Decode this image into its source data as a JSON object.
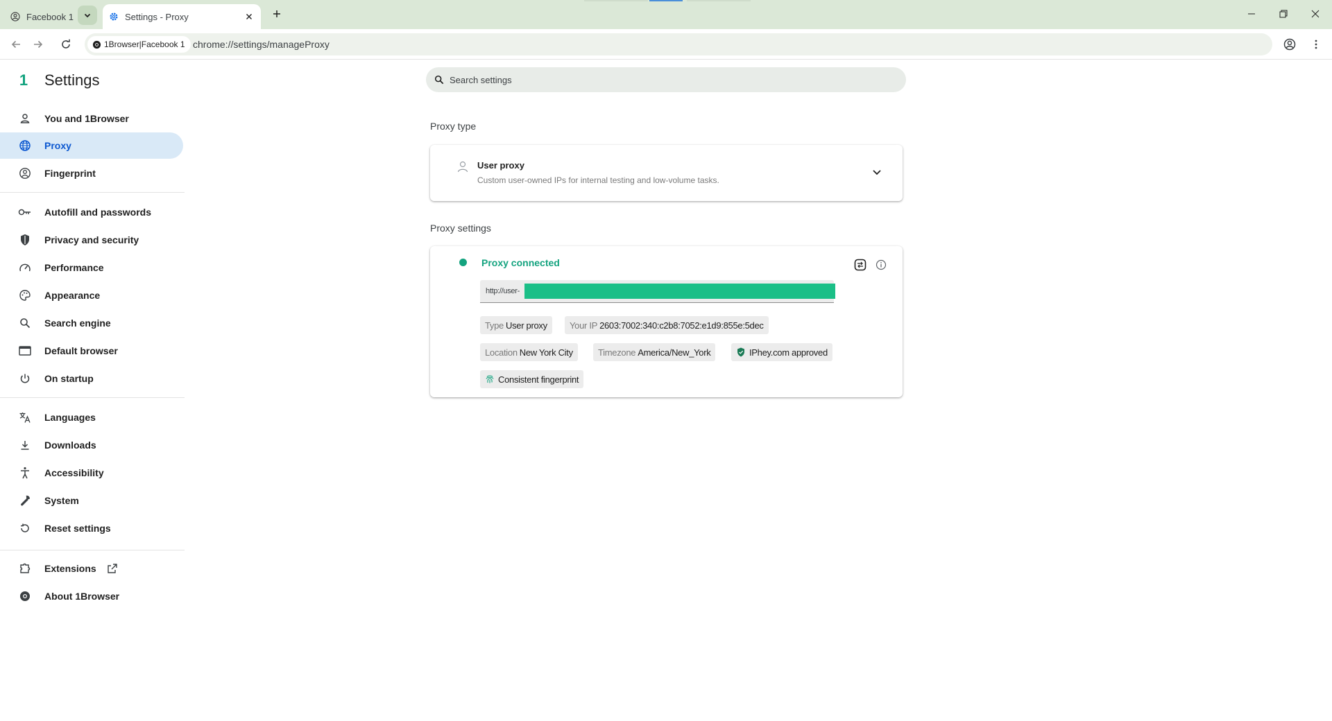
{
  "tabs": [
    {
      "title": "Facebook 1",
      "icon": "profile-icon"
    },
    {
      "title": "Settings - Proxy",
      "icon": "settings-gear-icon"
    }
  ],
  "toolbar": {
    "site_chip": "1Browser|Facebook 1",
    "url": "chrome://settings/manageProxy"
  },
  "sidebar": {
    "title": "Settings",
    "logo": "1",
    "items": [
      {
        "label": "You and 1Browser",
        "icon": "person-icon"
      },
      {
        "label": "Proxy",
        "icon": "globe-icon",
        "active": true
      },
      {
        "label": "Fingerprint",
        "icon": "fingerprint-icon"
      },
      {
        "label": "Autofill and passwords",
        "icon": "key-icon"
      },
      {
        "label": "Privacy and security",
        "icon": "shield-icon"
      },
      {
        "label": "Performance",
        "icon": "speedometer-icon"
      },
      {
        "label": "Appearance",
        "icon": "palette-icon"
      },
      {
        "label": "Search engine",
        "icon": "search-icon"
      },
      {
        "label": "Default browser",
        "icon": "browser-window-icon"
      },
      {
        "label": "On startup",
        "icon": "power-icon"
      },
      {
        "label": "Languages",
        "icon": "translate-icon"
      },
      {
        "label": "Downloads",
        "icon": "download-icon"
      },
      {
        "label": "Accessibility",
        "icon": "accessibility-icon"
      },
      {
        "label": "System",
        "icon": "wrench-icon"
      },
      {
        "label": "Reset settings",
        "icon": "reset-icon"
      },
      {
        "label": "Extensions",
        "icon": "puzzle-icon"
      },
      {
        "label": "About 1Browser",
        "icon": "info-logo-icon"
      }
    ]
  },
  "search": {
    "placeholder": "Search settings"
  },
  "proxy_type": {
    "section_title": "Proxy type",
    "name": "User proxy",
    "description": "Custom user-owned IPs for internal testing and low-volume tasks."
  },
  "proxy_settings": {
    "section_title": "Proxy settings",
    "status": "Proxy connected",
    "url_value": "http://user-",
    "chips": {
      "type_key": "Type",
      "type_val": "User proxy",
      "ip_key": "Your IP",
      "ip_val": "2603:7002:340:c2b8:7052:e1d9:855e:5dec",
      "location_key": "Location",
      "location_val": "New York City",
      "timezone_key": "Timezone",
      "timezone_val": "America/New_York",
      "approved": "IPhey.com approved",
      "fingerprint": "Consistent fingerprint"
    }
  },
  "colors": {
    "accent": "#14a37f",
    "active_nav_bg": "#d9e9f7",
    "active_nav_text": "#0b57d0",
    "tabstrip": "#dbe8d7"
  }
}
